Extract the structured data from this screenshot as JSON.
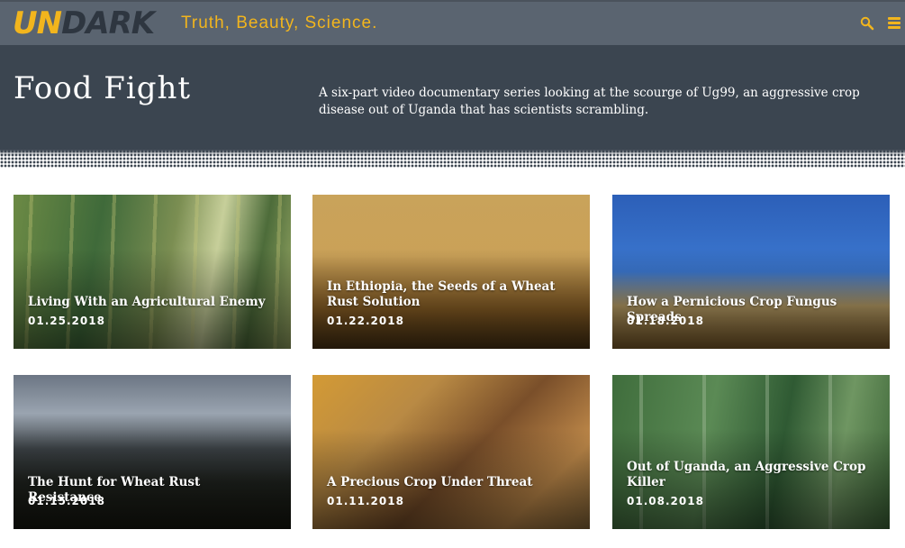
{
  "header": {
    "logo_un": "UN",
    "logo_dark": "DARK",
    "tagline": "Truth, Beauty, Science."
  },
  "hero": {
    "title": "Food Fight",
    "description": "A six-part video documentary series looking at the scourge of Ug99, an aggressive crop disease out of Uganda that has scientists scrambling."
  },
  "cards": [
    {
      "title": "Living With an Agricultural Enemy",
      "date": "01.25.2018"
    },
    {
      "title": "In Ethiopia, the Seeds of a Wheat Rust Solution",
      "date": "01.22.2018"
    },
    {
      "title": "How a Pernicious Crop Fungus Spreads",
      "date": "01.18.2018"
    },
    {
      "title": "The Hunt for Wheat Rust Resistance",
      "date": "01.15.2018"
    },
    {
      "title": "A Precious Crop Under Threat",
      "date": "01.11.2018"
    },
    {
      "title": "Out of Uganda, an Aggressive Crop Killer",
      "date": "01.08.2018"
    }
  ],
  "colors": {
    "accent": "#f2b51d",
    "header_bg": "#5a6470",
    "hero_bg": "#3b4550"
  },
  "icons": {
    "search": "search-icon",
    "menu": "menu-icon"
  }
}
